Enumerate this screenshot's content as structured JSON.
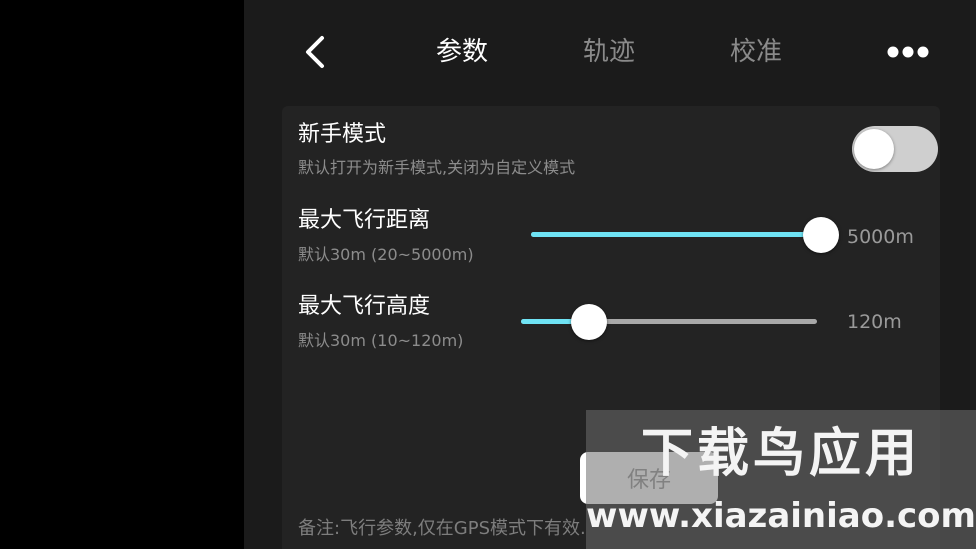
{
  "header": {
    "tabs": [
      {
        "label": "参数",
        "active": true
      },
      {
        "label": "轨迹",
        "active": false
      },
      {
        "label": "校准",
        "active": false
      }
    ]
  },
  "settings": {
    "novice_mode": {
      "title": "新手模式",
      "subtitle": "默认打开为新手模式,关闭为自定义模式",
      "enabled": false
    },
    "max_distance": {
      "title": "最大飞行距离",
      "subtitle": "默认30m (20~5000m)",
      "value_label": "5000m",
      "min": 20,
      "max": 5000,
      "value": 5000
    },
    "max_altitude": {
      "title": "最大飞行高度",
      "subtitle": "默认30m (10~120m)",
      "value_label": "120m",
      "min": 10,
      "max": 120,
      "value": 120,
      "fill_fraction": 0.23
    }
  },
  "save_label": "保存",
  "note": "备注:飞行参数,仅在GPS模式下有效.",
  "watermark": {
    "line1": "下载鸟应用",
    "line2": "www.xiazainiao.com"
  },
  "colors": {
    "accent": "#6fe3f4",
    "panel_bg": "#1b1b1b",
    "card_bg": "#232323"
  }
}
